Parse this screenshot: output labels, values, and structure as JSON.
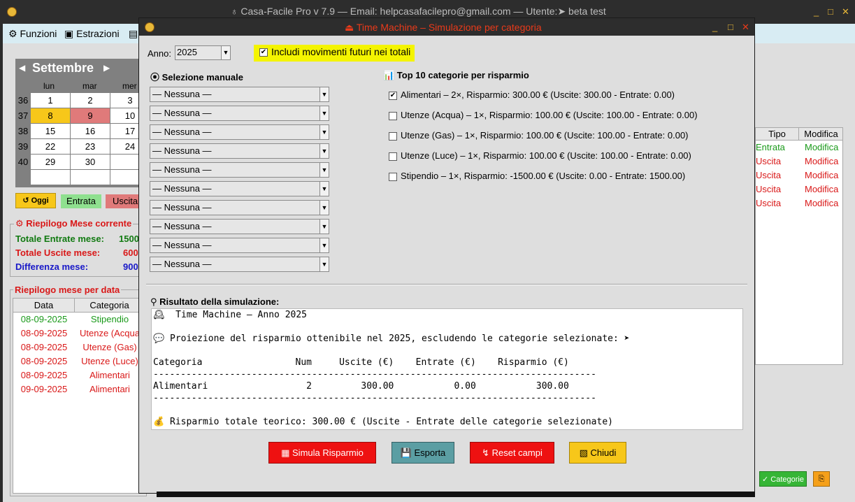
{
  "main_window": {
    "title": "♁ Casa-Facile Pro v 7.9  — Email: helpcasafacilepro@gmail.com —  Utente:➤ beta test",
    "controls": [
      "_",
      "□",
      "✕"
    ],
    "menu": [
      {
        "icon": "gear-icon",
        "glyph": "⚙",
        "label": "Funzioni"
      },
      {
        "icon": "card-icon",
        "glyph": "▣",
        "label": "Estrazioni"
      },
      {
        "icon": "doc-icon",
        "glyph": "▤",
        "label": ""
      }
    ]
  },
  "calendar": {
    "month": "Settembre",
    "prev": "◀",
    "next": "▶",
    "day_headers": [
      "lun",
      "mar",
      "mer"
    ],
    "weeks": [
      {
        "num": "36",
        "days": [
          "1",
          "2",
          "3"
        ]
      },
      {
        "num": "37",
        "days": [
          "8",
          "9",
          "10"
        ]
      },
      {
        "num": "38",
        "days": [
          "15",
          "16",
          "17"
        ]
      },
      {
        "num": "39",
        "days": [
          "22",
          "23",
          "24"
        ]
      },
      {
        "num": "40",
        "days": [
          "29",
          "30",
          ""
        ]
      },
      {
        "num": "",
        "days": [
          "",
          "",
          ""
        ]
      }
    ],
    "today_btn": "↺ Oggi",
    "legend_entrata": "Entrata",
    "legend_uscita": "Uscita"
  },
  "summary": {
    "title": "⚙ Riepilogo Mese corrente",
    "entrate_label": "Totale Entrate mese:",
    "entrate_value": "1500",
    "uscite_label": "Totale Uscite mese:",
    "uscite_value": "600",
    "diff_label": "Differenza mese:",
    "diff_value": "900",
    "colors": {
      "entrate": "#117a11",
      "uscite": "#d91818",
      "diff": "#1818c8"
    }
  },
  "by_date": {
    "title": "Riepilogo mese per data",
    "columns": [
      "Data",
      "Categoria"
    ],
    "rows": [
      {
        "data": "08-09-2025",
        "categoria": "Stipendio",
        "kind": "entrata"
      },
      {
        "data": "08-09-2025",
        "categoria": "Utenze (Acqua",
        "kind": "uscita"
      },
      {
        "data": "08-09-2025",
        "categoria": "Utenze (Gas)",
        "kind": "uscita"
      },
      {
        "data": "08-09-2025",
        "categoria": "Utenze (Luce)",
        "kind": "uscita"
      },
      {
        "data": "08-09-2025",
        "categoria": "Alimentari",
        "kind": "uscita"
      },
      {
        "data": "09-09-2025",
        "categoria": "Alimentari",
        "kind": "uscita"
      }
    ]
  },
  "right_table": {
    "columns": [
      "Tipo",
      "Modifica"
    ],
    "rows": [
      {
        "tipo": "Entrata",
        "modifica": "Modifica",
        "kind": "entrata"
      },
      {
        "tipo": "Uscita",
        "modifica": "Modifica",
        "kind": "uscita"
      },
      {
        "tipo": "Uscita",
        "modifica": "Modifica",
        "kind": "uscita"
      },
      {
        "tipo": "Uscita",
        "modifica": "Modifica",
        "kind": "uscita"
      },
      {
        "tipo": "Uscita",
        "modifica": "Modifica",
        "kind": "uscita"
      }
    ],
    "categorie_btn": "✓ Categorie",
    "small_btn": "⎘"
  },
  "dialog": {
    "title": "⏏ Time Machine – Simulazione per categoria",
    "controls": [
      "_",
      "□",
      "✕"
    ],
    "anno_label": "Anno:",
    "anno_value": "2025",
    "include_future_label": "Includi movimenti futuri nei totali",
    "include_future_checked": true,
    "manual_title": "⦿ Selezione manuale",
    "manual_selects": [
      "— Nessuna —",
      "— Nessuna —",
      "— Nessuna —",
      "— Nessuna —",
      "— Nessuna —",
      "— Nessuna —",
      "— Nessuna —",
      "— Nessuna —",
      "— Nessuna —",
      "— Nessuna —"
    ],
    "top_title": "📊 Top 10 categorie per risparmio",
    "top_items": [
      {
        "label": "Alimentari – 2×, Risparmio: 300.00 € (Uscite: 300.00 - Entrate: 0.00)",
        "checked": true
      },
      {
        "label": "Utenze (Acqua) – 1×, Risparmio: 100.00 € (Uscite: 100.00 - Entrate: 0.00)",
        "checked": false
      },
      {
        "label": "Utenze (Gas) – 1×, Risparmio: 100.00 € (Uscite: 100.00 - Entrate: 0.00)",
        "checked": false
      },
      {
        "label": "Utenze (Luce) – 1×, Risparmio: 100.00 € (Uscite: 100.00 - Entrate: 0.00)",
        "checked": false
      },
      {
        "label": "Stipendio – 1×, Risparmio: -1500.00 € (Uscite: 0.00 - Entrate: 1500.00)",
        "checked": false
      }
    ],
    "result_title": "⚲ Risultato della simulazione:",
    "result_lines": [
      "🕰  Time Machine – Anno 2025",
      "",
      "💬 Proiezione del risparmio ottenibile nel 2025, escludendo le categorie selezionate: ➤",
      "",
      "Categoria                 Num     Uscite (€)    Entrate (€)    Risparmio (€)",
      "---------------------------------------------------------------------------------",
      "Alimentari                  2         300.00           0.00           300.00",
      "---------------------------------------------------------------------------------",
      "",
      "💰 Risparmio totale teorico: 300.00 € (Uscite - Entrate delle categorie selezionate)"
    ],
    "buttons": {
      "simula": "▦ Simula Risparmio",
      "esporta": "💾 Esporta",
      "reset": "↯ Reset campi",
      "chiudi": "▧ Chiudi"
    }
  },
  "colors": {
    "entrata_text": "#1a9a1a",
    "uscita_text": "#d91818",
    "title_red": "#e93a1a",
    "highlight_yellow": "#f4f400"
  }
}
